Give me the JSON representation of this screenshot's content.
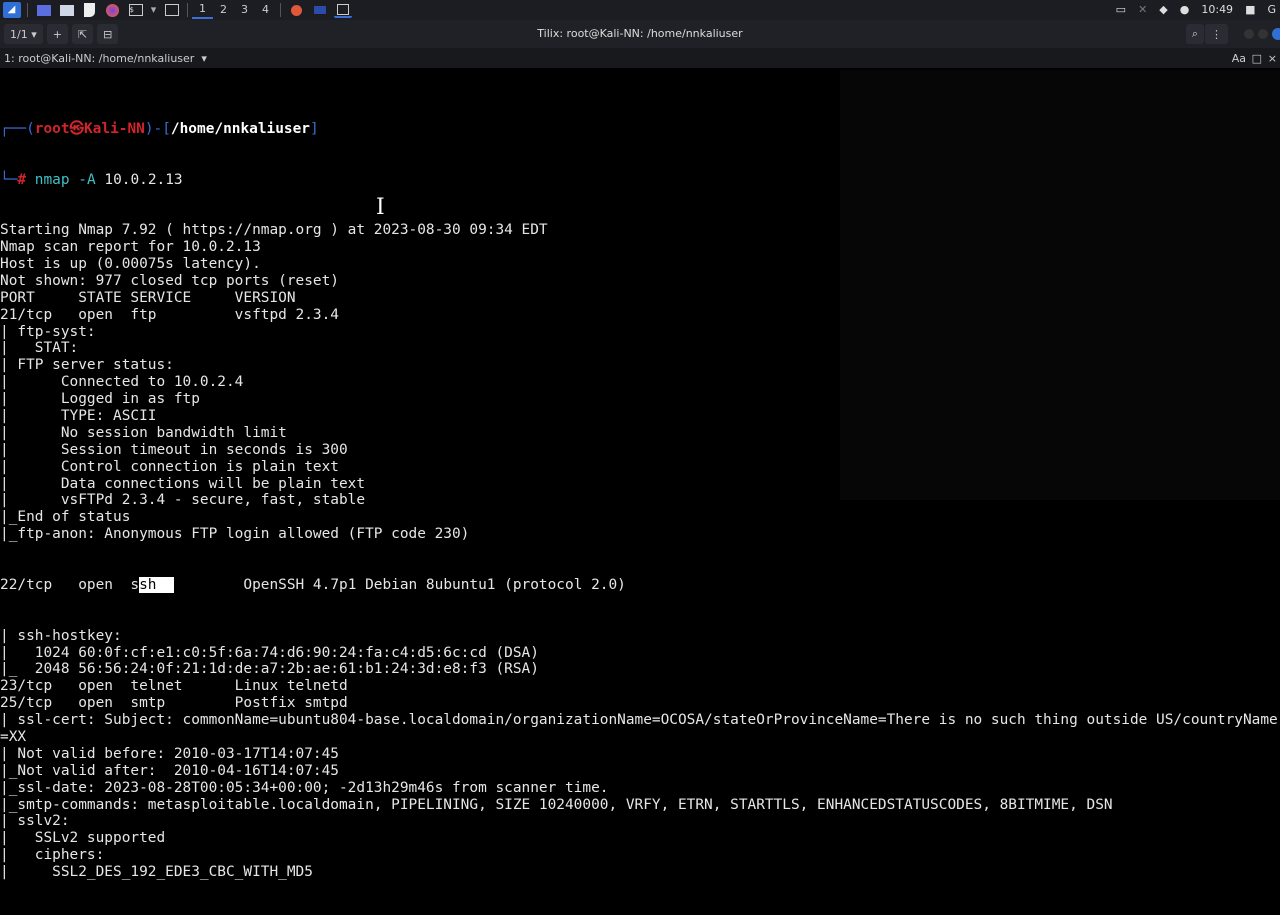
{
  "panel": {
    "workspaces": [
      "1",
      "2",
      "3",
      "4"
    ],
    "clock": "10:49"
  },
  "window": {
    "title": "Tilix: root@Kali-NN: /home/nnkaliuser",
    "session_count": "1/1",
    "tab_label": "1: root@Kali-NN: /home/nnkaliuser"
  },
  "prompt": {
    "user_host": "root㉿Kali-NN",
    "path": "/home/nnkaliuser",
    "hash": "#",
    "cmd": "nmap",
    "flag": "-A",
    "arg": "10.0.2.13"
  },
  "output_before": [
    "Starting Nmap 7.92 ( https://nmap.org ) at 2023-08-30 09:34 EDT",
    "Nmap scan report for 10.0.2.13",
    "Host is up (0.00075s latency).",
    "Not shown: 977 closed tcp ports (reset)",
    "PORT     STATE SERVICE     VERSION",
    "21/tcp   open  ftp         vsftpd 2.3.4",
    "| ftp-syst: ",
    "|   STAT: ",
    "| FTP server status:",
    "|      Connected to 10.0.2.4",
    "|      Logged in as ftp",
    "|      TYPE: ASCII",
    "|      No session bandwidth limit",
    "|      Session timeout in seconds is 300",
    "|      Control connection is plain text",
    "|      Data connections will be plain text",
    "|      vsFTPd 2.3.4 - secure, fast, stable",
    "|_End of status",
    "|_ftp-anon: Anonymous FTP login allowed (FTP code 230)"
  ],
  "ssh_line": {
    "pre": "22/tcp   open  s",
    "selected": "sh  ",
    "post": "        OpenSSH 4.7p1 Debian 8ubuntu1 (protocol 2.0)"
  },
  "output_after": [
    "| ssh-hostkey: ",
    "|   1024 60:0f:cf:e1:c0:5f:6a:74:d6:90:24:fa:c4:d5:6c:cd (DSA)",
    "|_  2048 56:56:24:0f:21:1d:de:a7:2b:ae:61:b1:24:3d:e8:f3 (RSA)",
    "23/tcp   open  telnet      Linux telnetd",
    "25/tcp   open  smtp        Postfix smtpd",
    "| ssl-cert: Subject: commonName=ubuntu804-base.localdomain/organizationName=OCOSA/stateOrProvinceName=There is no such thing outside US/countryName",
    "=XX",
    "| Not valid before: 2010-03-17T14:07:45",
    "|_Not valid after:  2010-04-16T14:07:45",
    "|_ssl-date: 2023-08-28T00:05:34+00:00; -2d13h29m46s from scanner time.",
    "|_smtp-commands: metasploitable.localdomain, PIPELINING, SIZE 10240000, VRFY, ETRN, STARTTLS, ENHANCEDSTATUSCODES, 8BITMIME, DSN",
    "| sslv2: ",
    "|   SSLv2 supported",
    "|   ciphers: ",
    "|     SSL2_DES_192_EDE3_CBC_WITH_MD5"
  ]
}
